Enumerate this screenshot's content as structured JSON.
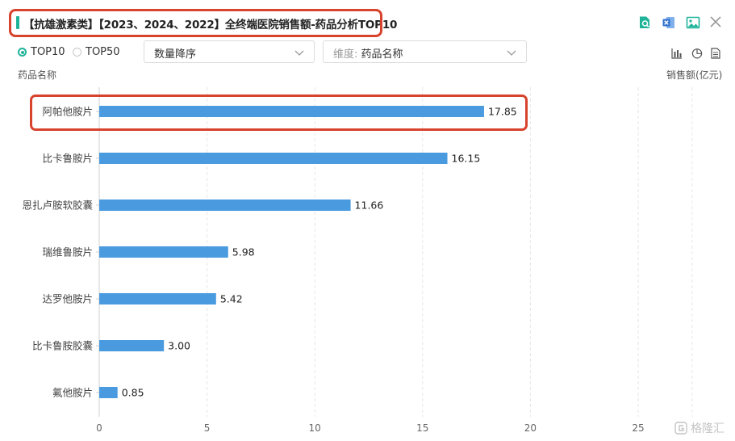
{
  "header": {
    "title": "【抗雄激素类】【2023、2024、2022】全终端医院销售额-药品分析TOP10",
    "tools": [
      "search-file-icon",
      "excel-export-icon",
      "image-export-icon",
      "close-icon"
    ]
  },
  "controls": {
    "radio_top10": "TOP10",
    "radio_top50": "TOP50",
    "sort_select": "数量降序",
    "dimension_prefix": "维度:",
    "dimension_value": "药品名称",
    "view_tools": [
      "bar-chart-icon",
      "pie-chart-icon",
      "table-icon"
    ]
  },
  "axis_titles": {
    "y": "药品名称",
    "x": "销售额(亿元)"
  },
  "chart_data": {
    "type": "bar",
    "orientation": "horizontal",
    "categories": [
      "阿帕他胺片",
      "比卡鲁胺片",
      "恩扎卢胺软胶囊",
      "瑞维鲁胺片",
      "达罗他胺片",
      "比卡鲁胺胶囊",
      "氟他胺片"
    ],
    "values": [
      17.85,
      16.15,
      11.66,
      5.98,
      5.42,
      3.0,
      0.85
    ],
    "value_labels": [
      "17.85",
      "16.15",
      "11.66",
      "5.98",
      "5.42",
      "3.00",
      "0.85"
    ],
    "xticks": [
      "0",
      "5",
      "10",
      "15",
      "20",
      "25"
    ],
    "xlim": [
      0,
      27.5
    ],
    "xlabel": "销售额(亿元)",
    "ylabel": "药品名称",
    "bar_color": "#4a9ae0",
    "highlight_category": "阿帕他胺片",
    "grid": true
  },
  "colors": {
    "accent": "#1fb39a",
    "highlight": "#d8432d",
    "icon_blue": "#3a7bd5"
  },
  "watermark": "格隆汇"
}
